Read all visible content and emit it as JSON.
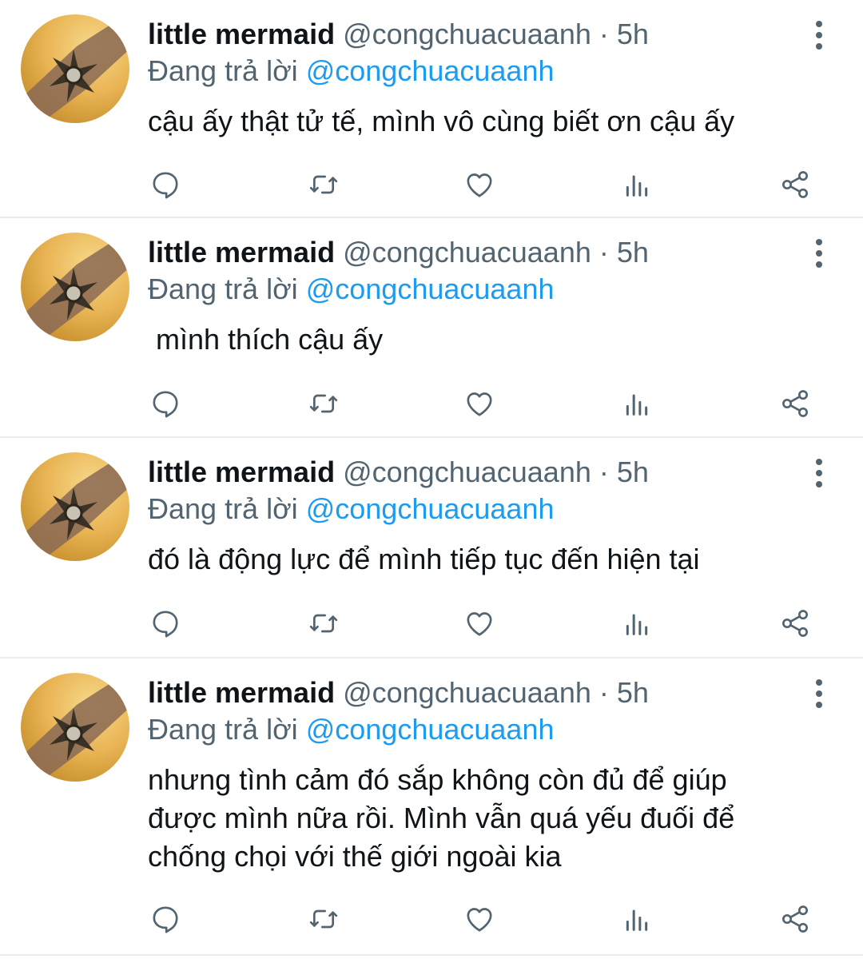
{
  "tweets": [
    {
      "name": "little mermaid",
      "handle": "@congchuacuaanh",
      "separator": "·",
      "time": "5h",
      "reply_prefix": "Đang trả lời",
      "reply_handle": "@congchuacuaanh",
      "text": "cậu ấy thật tử tế, mình vô cùng biết ơn cậu ấy"
    },
    {
      "name": "little mermaid",
      "handle": "@congchuacuaanh",
      "separator": "·",
      "time": "5h",
      "reply_prefix": "Đang trả lời",
      "reply_handle": "@congchuacuaanh",
      "text": " mình thích cậu ấy"
    },
    {
      "name": "little mermaid",
      "handle": "@congchuacuaanh",
      "separator": "·",
      "time": "5h",
      "reply_prefix": "Đang trả lời",
      "reply_handle": "@congchuacuaanh",
      "text": "đó là động lực để mình tiếp tục đến hiện tại"
    },
    {
      "name": "little mermaid",
      "handle": "@congchuacuaanh",
      "separator": "·",
      "time": "5h",
      "reply_prefix": "Đang trả lời",
      "reply_handle": "@congchuacuaanh",
      "text": "nhưng tình cảm đó sắp không còn đủ để giúp\nđược mình nữa rồi. Mình vẫn quá yếu đuối để\nchống chọi với thế giới ngoài kia"
    }
  ],
  "icons": {
    "reply": "reply-icon",
    "retweet": "retweet-icon",
    "like": "like-icon",
    "views": "views-icon",
    "share": "share-icon",
    "more": "more-icon"
  },
  "colors": {
    "text": "#0f1419",
    "secondary": "#536471",
    "link": "#1d9bf0",
    "divider": "#e6ecf0"
  }
}
